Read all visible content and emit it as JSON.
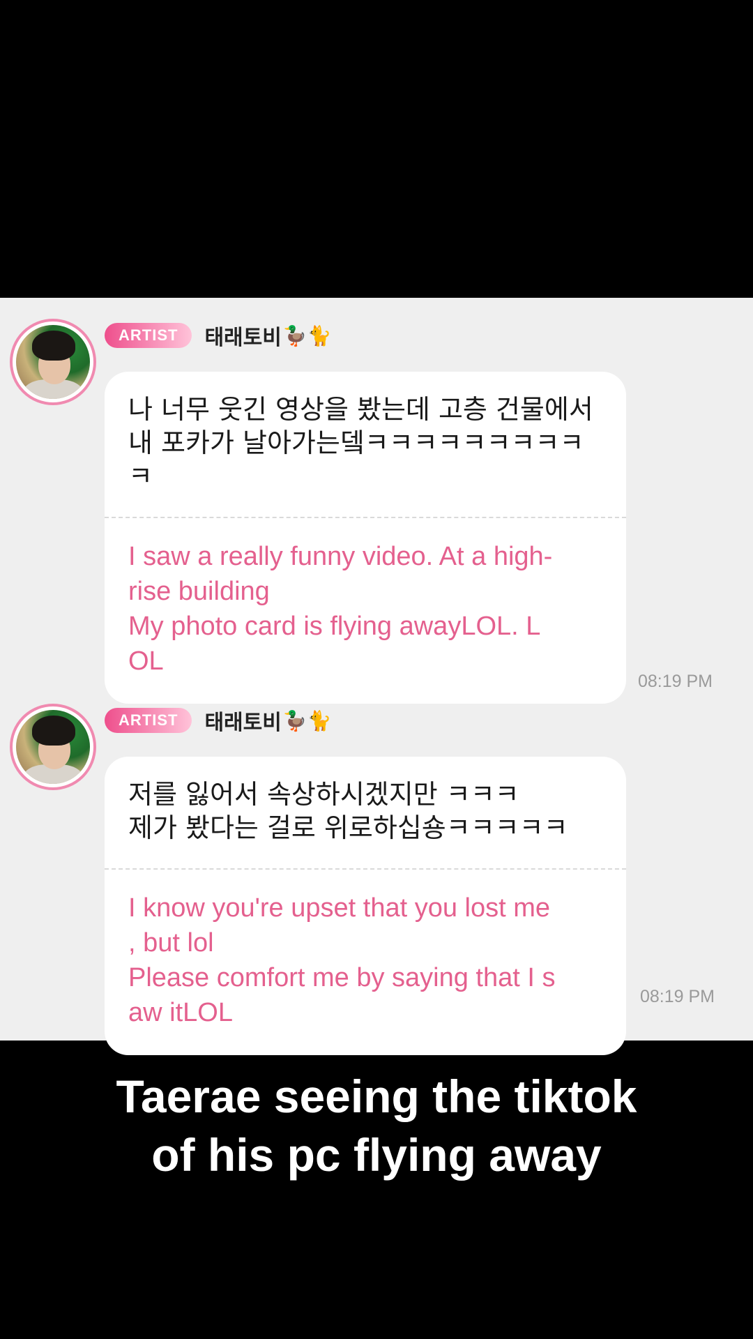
{
  "messages": [
    {
      "badge": "ARTIST",
      "sender": "태래토비",
      "sender_emoji": "🦆🐈",
      "original": "나 너무 웃긴 영상을 봤는데 고층 건물에서\n내 포카가 날아가는뎈ㅋㅋㅋㅋㅋㅋㅋㅋㅋ\nㅋ",
      "translation": "I saw a really funny video. At a high-\nrise building\nMy photo card is flying awayLOL. L\nOL",
      "time": "08:19 PM"
    },
    {
      "badge": "ARTIST",
      "sender": "태래토비",
      "sender_emoji": "🦆🐈",
      "original": "저를 잃어서 속상하시겠지만 ㅋㅋㅋ\n제가 봤다는 걸로 위로하십숑ㅋㅋㅋㅋㅋ",
      "translation": "I know you're upset that you lost me\n, but lol\nPlease comfort me by saying that I s\naw itLOL",
      "time": "08:19 PM"
    }
  ],
  "caption": {
    "line1": "Taerae seeing the tiktok",
    "line2": "of his pc flying away"
  },
  "colors": {
    "badge_start": "#ee4f8c",
    "translation": "#e4608e",
    "panel": "#efefef",
    "avatar_ring": "#f08ab0"
  },
  "icons": {
    "avatar": "profile-photo",
    "name_emoji": "duck-and-cat-emoji"
  }
}
